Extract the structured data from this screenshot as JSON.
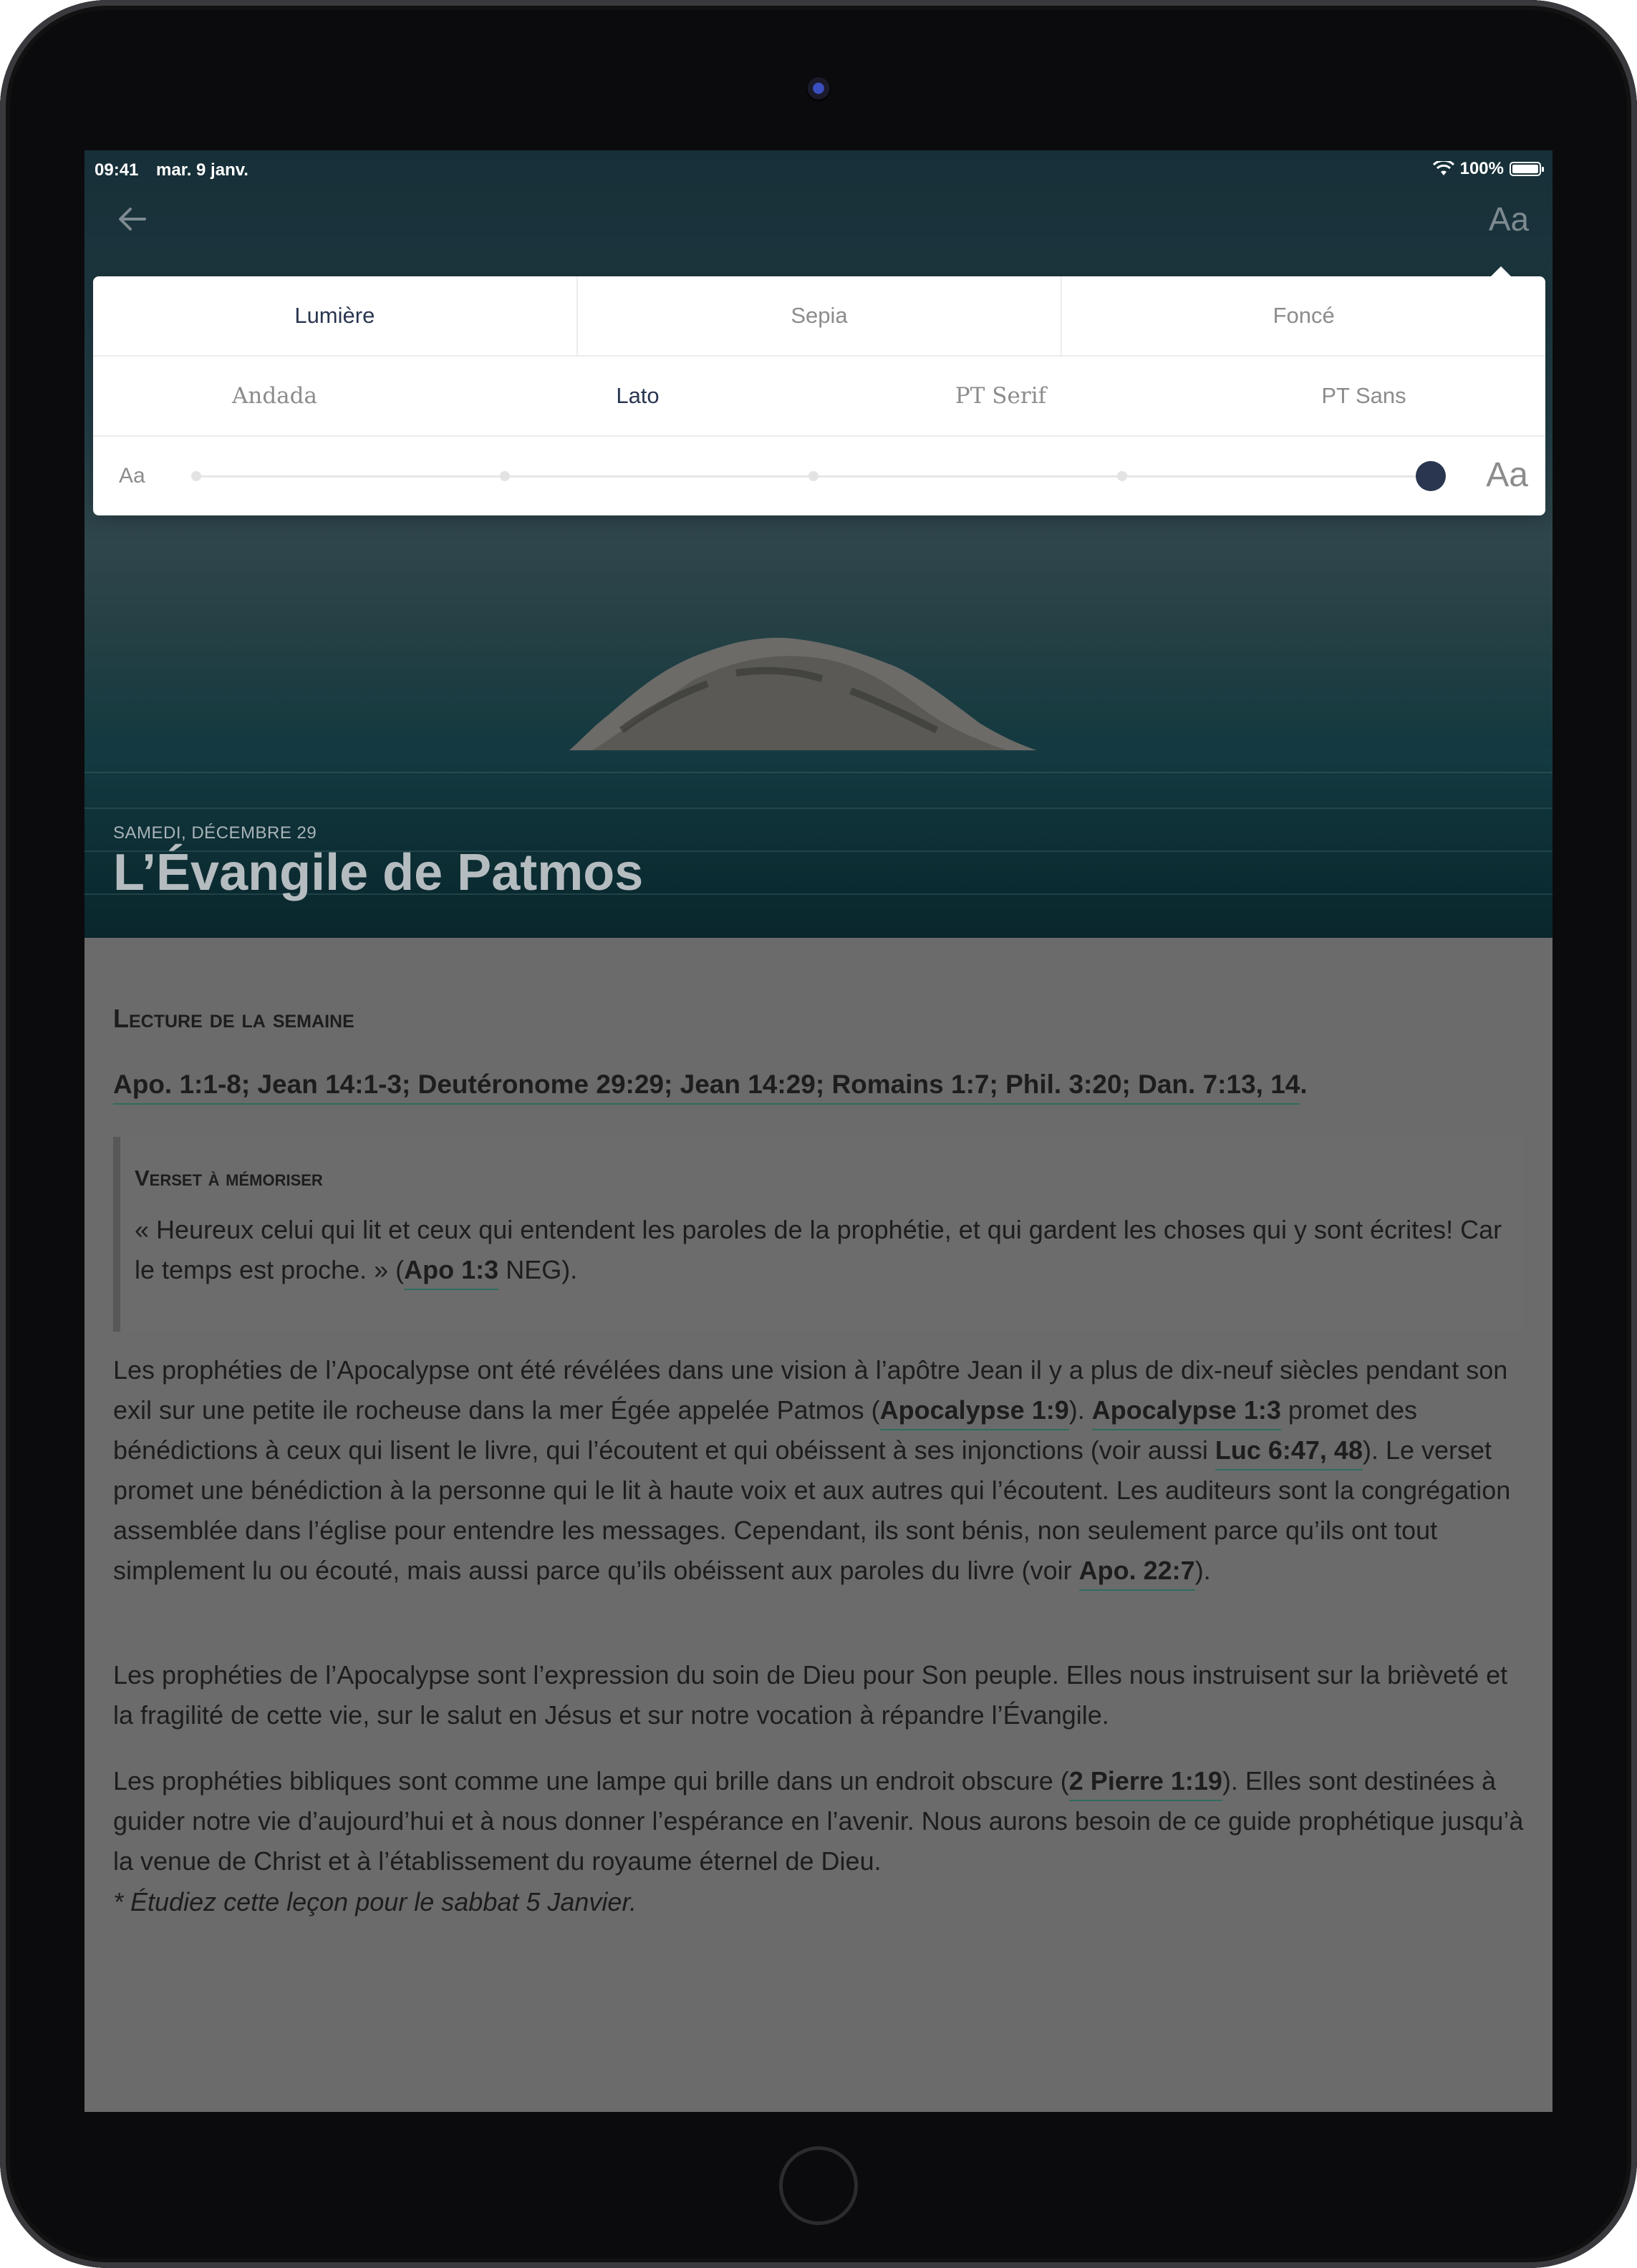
{
  "status_bar": {
    "time": "09:41",
    "date": "mar. 9 janv.",
    "battery": "100%"
  },
  "toolbar": {
    "text_settings_label": "Aa"
  },
  "reader_settings": {
    "themes": [
      "Lumière",
      "Sepia",
      "Foncé"
    ],
    "selected_theme": "Lumière",
    "fonts": [
      "Andada",
      "Lato",
      "PT Serif",
      "PT Sans"
    ],
    "selected_font": "Lato",
    "size_small_label": "Aa",
    "size_large_label": "Aa",
    "size_steps": 5,
    "size_level": 5
  },
  "lesson": {
    "date": "SAMEDI, DÉCEMBRE 29",
    "title": "L’Évangile de Patmos"
  },
  "weekly_reading": {
    "title": "Lecture de la semaine",
    "refs": "Apo. 1:1-8; Jean 14:1-3; Deutéronome 29:29; Jean 14:29; Romains 1:7; Phil. 3:20; Dan. 7:13, 14",
    "after": "."
  },
  "memory_verse": {
    "title": "Verset à mémoriser",
    "text": "« Heureux celui qui lit et ceux qui entendent les paroles de la prophétie, et qui gardent les choses qui y sont écrites! Car le temps est proche. » (",
    "ref": "Apo 1:3",
    "after": " NEG)."
  },
  "paragraphs": [
    {
      "p1": "Les prophéties de l’Apocalypse ont été révélées dans une vision à l’apôtre Jean il y a plus de dix-neuf siècles pendant son exil sur une petite ile rocheuse dans la mer Égée appelée Patmos (",
      "r1": "Apocalypse 1:9",
      "p2": "). ",
      "r2": "Apocalypse 1:3",
      "p3": " promet des bénédictions à ceux qui lisent le livre, qui l’écoutent et qui obéissent à ses injonctions (voir aussi ",
      "r3": "Luc 6:47, 48",
      "p4": "). Le verset promet une bénédiction à la personne qui le lit à haute voix et aux autres qui l’écoutent. Les auditeurs sont la congrégation assemblée dans l’église pour entendre les messages. Cependant, ils sont bénis, non seulement parce qu’ils ont tout simplement lu ou écouté, mais aussi parce qu’ils obéissent aux paroles du livre (voir ",
      "r4": "Apo. 22:7",
      "p5": ")."
    },
    {
      "p1": "Les prophéties de l’Apocalypse sont l’expression du soin de Dieu pour Son peuple. Elles nous instruisent sur la brièveté et la fragilité de cette vie, sur le salut en Jésus et sur notre vocation à répandre l’Évangile."
    },
    {
      "p1": "Les prophéties bibliques sont comme une lampe qui brille dans un endroit obscure (",
      "r1": "2 Pierre 1:19",
      "p2": "). Elles sont destinées à guider notre vie d’aujourd’hui et à nous donner l’espérance en l’avenir. Nous aurons besoin de ce guide prophétique jusqu’à la venue de Christ et à l’établissement du royaume éternel de Dieu."
    }
  ],
  "study_note": "* Étudiez cette leçon pour le sabbat 5 Janvier.",
  "colors": {
    "accent": "#2a3650",
    "link_underline": "#2f6b5f",
    "dim_overlay": "#6b6b6b"
  }
}
